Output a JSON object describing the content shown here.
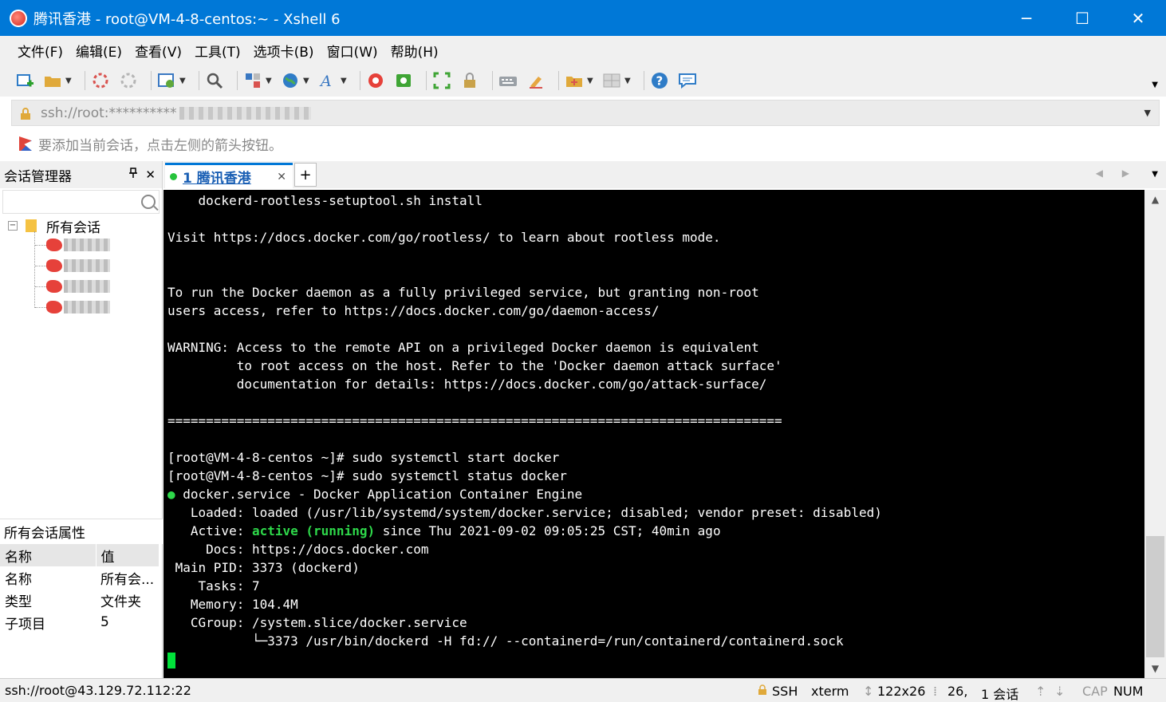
{
  "window": {
    "title": "腾讯香港 - root@VM-4-8-centos:~ - Xshell 6",
    "controls": {
      "minimize": "─",
      "maximize": "☐",
      "close": "✕"
    }
  },
  "menubar": {
    "items": [
      "文件(F)",
      "编辑(E)",
      "查看(V)",
      "工具(T)",
      "选项卡(B)",
      "窗口(W)",
      "帮助(H)"
    ]
  },
  "toolbar": {
    "icons": [
      "new-session-icon",
      "open-folder-icon",
      "disconnect-icon",
      "reconnect-icon",
      "properties-icon",
      "find-icon",
      "transfer-icon",
      "globe-icon",
      "font-icon",
      "xshell-icon",
      "xftp-icon",
      "fullscreen-icon",
      "lock-icon",
      "keyboard-icon",
      "highlight-icon",
      "add-folder-icon",
      "layout-icon",
      "help-icon",
      "chat-icon"
    ]
  },
  "address": {
    "value": "ssh://root:**********"
  },
  "hint": {
    "text": "要添加当前会话，点击左侧的箭头按钮。"
  },
  "session_manager": {
    "title": "会话管理器",
    "pin": "📌",
    "close": "✕",
    "root_label": "所有会话",
    "expander": "−"
  },
  "properties": {
    "title": "所有会话属性",
    "headers": [
      "名称",
      "值"
    ],
    "rows": [
      {
        "key": "名称",
        "value": "所有会..."
      },
      {
        "key": "类型",
        "value": "文件夹"
      },
      {
        "key": "子项目",
        "value": "5"
      }
    ]
  },
  "tabs": {
    "active": {
      "label": "1 腾讯香港",
      "close": "✕"
    },
    "add": "+",
    "nav": "◀ ▶",
    "dropdown": "▼"
  },
  "terminal": {
    "lines": [
      "    dockerd-rootless-setuptool.sh install",
      "",
      "Visit https://docs.docker.com/go/rootless/ to learn about rootless mode.",
      "",
      "",
      "To run the Docker daemon as a fully privileged service, but granting non-root",
      "users access, refer to https://docs.docker.com/go/daemon-access/",
      "",
      "WARNING: Access to the remote API on a privileged Docker daemon is equivalent",
      "         to root access on the host. Refer to the 'Docker daemon attack surface'",
      "         documentation for details: https://docs.docker.com/go/attack-surface/",
      "",
      "================================================================================",
      "",
      "[root@VM-4-8-centos ~]# sudo systemctl start docker",
      "[root@VM-4-8-centos ~]# sudo systemctl status docker"
    ],
    "status_dot": "●",
    "status_service": " docker.service - Docker Application Container Engine",
    "loaded": "   Loaded: loaded (/usr/lib/systemd/system/docker.service; disabled; vendor preset: disabled)",
    "active_label": "   Active: ",
    "active_state": "active (running)",
    "active_since": " since Thu 2021-09-02 09:05:25 CST; 40min ago",
    "docs": "     Docs: https://docs.docker.com",
    "main_pid": " Main PID: 3373 (dockerd)",
    "tasks": "    Tasks: 7",
    "memory": "   Memory: 104.4M",
    "cgroup": "   CGroup: /system.slice/docker.service",
    "cgroup_child": "           └─3373 /usr/bin/dockerd -H fd:// --containerd=/run/containerd/containerd.sock"
  },
  "statusbar": {
    "connection": "ssh://root@43.129.72.112:22",
    "protocol": "SSH",
    "terminal_type": "xterm",
    "size": "122x26",
    "position": "26,",
    "sessions": "1 会话",
    "cap": "CAP",
    "num": "NUM"
  },
  "colors": {
    "titlebar": "#0078d7",
    "terminal_bg": "#000000",
    "terminal_green": "#2ed84a",
    "cursor": "#00e23a"
  }
}
